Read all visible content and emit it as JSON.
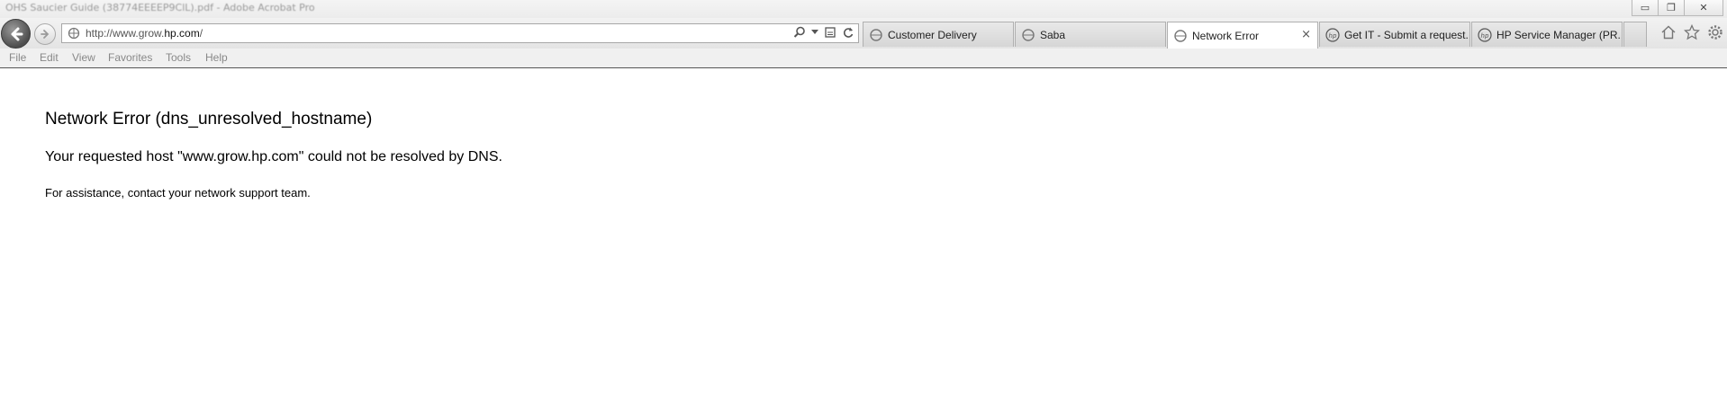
{
  "window": {
    "title": "OHS Saucier Guide (38774EEEEP9ClL).pdf - Adobe Acrobat Pro",
    "controls": {
      "minimize": "▭",
      "restore": "❐",
      "close": "✕"
    }
  },
  "nav": {
    "back_icon": "back-arrow-icon",
    "forward_icon": "forward-arrow-icon"
  },
  "address_bar": {
    "url_prefix": "http://www.grow.",
    "url_domain": "hp.com",
    "url_suffix": "/",
    "tools": [
      "search-icon",
      "dropdown-icon",
      "compatibility-view-icon",
      "refresh-icon"
    ]
  },
  "tabs": [
    {
      "label": "Customer Delivery",
      "icon": "ie-page-icon",
      "active": false
    },
    {
      "label": "Saba",
      "icon": "ie-page-icon",
      "active": false
    },
    {
      "label": "Network Error",
      "icon": "ie-page-icon",
      "active": true,
      "close": "×"
    },
    {
      "label": "Get IT - Submit a request...",
      "icon": "hp-logo-icon",
      "active": false
    },
    {
      "label": "HP Service Manager (PR...",
      "icon": "hp-logo-icon",
      "active": false
    }
  ],
  "toolbar_right": [
    "home-icon",
    "favorites-star-icon",
    "settings-gear-icon"
  ],
  "menu": [
    "File",
    "Edit",
    "View",
    "Favorites",
    "Tools",
    "Help"
  ],
  "page": {
    "heading": "Network Error (dns_unresolved_hostname)",
    "message": "Your requested host \"www.grow.hp.com\" could not be resolved by DNS.",
    "help": "For assistance, contact your network support team."
  },
  "colors": {
    "background": "#ffffff",
    "chrome": "#e8e8e8",
    "menu_text": "#888888"
  }
}
